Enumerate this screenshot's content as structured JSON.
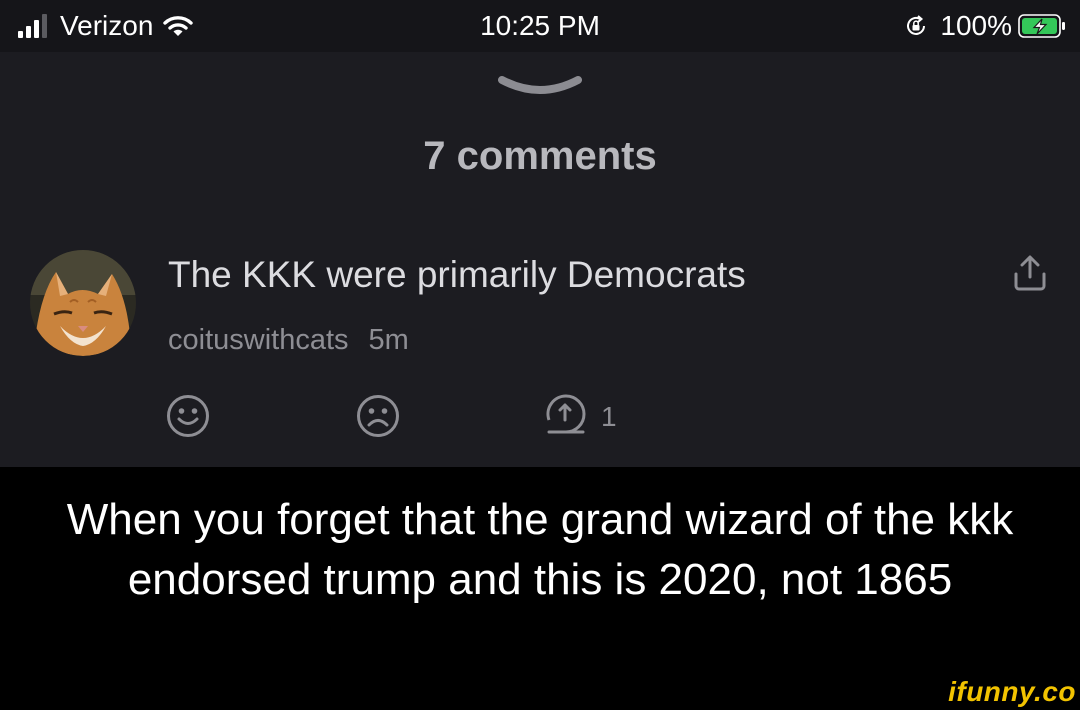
{
  "status_bar": {
    "carrier": "Verizon",
    "time": "10:25 PM",
    "battery": "100%"
  },
  "sheet": {
    "title": "7 comments"
  },
  "comment": {
    "text": "The KKK were primarily Democrats",
    "username": "coituswithcats",
    "age": "5m",
    "reply_count": "1",
    "avatar_icon": "cat-avatar",
    "actions": [
      "smile-icon",
      "frown-icon",
      "reply-icon",
      "share-icon"
    ]
  },
  "caption": {
    "text": "When you forget that the grand wizard of the kkk endorsed trump and this is 2020, not 1865"
  },
  "watermark": "ifunny.co",
  "colors": {
    "sheet_background": "#1c1c21",
    "caption_background": "#000000",
    "watermark": "#f2c300",
    "battery_fill": "#34c759"
  }
}
